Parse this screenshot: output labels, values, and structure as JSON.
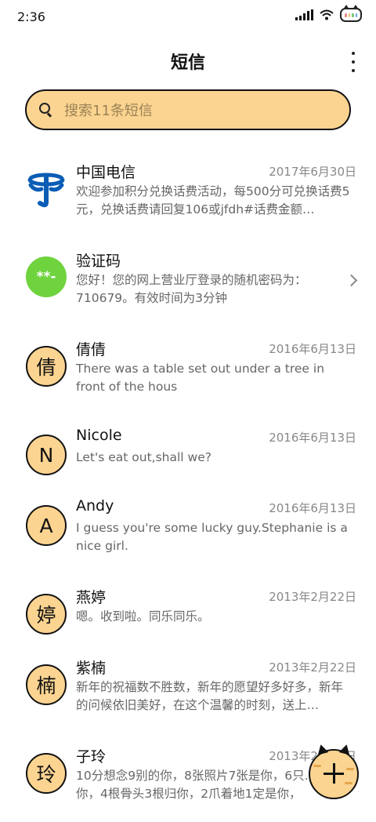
{
  "status_bar": {
    "time": "2:36"
  },
  "header": {
    "title": "短信"
  },
  "search": {
    "placeholder": "搜索11条短信"
  },
  "conversations": [
    {
      "name": "中国电信",
      "date": "2017年6月30日",
      "snippet": "欢迎参加积分兑换话费活动，每500分可兑换话费5元，兑换话费请回复106或jfdh#话费金额…",
      "avatar_type": "china-telecom-logo"
    },
    {
      "name": "验证码",
      "date": "",
      "snippet": "您好！您的网上营业厅登录的随机密码为：710679。有效时间为3分钟",
      "avatar_type": "verification-code",
      "avatar_text": "**-"
    },
    {
      "name": "倩倩",
      "date": "2016年6月13日",
      "snippet": "There was a table set out under a tree in front of the hous",
      "avatar_text": "倩"
    },
    {
      "name": "Nicole",
      "date": "2016年6月13日",
      "snippet": "Let's eat out,shall we?",
      "avatar_text": "N"
    },
    {
      "name": "Andy",
      "date": "2016年6月13日",
      "snippet": "I guess you're some lucky guy.Stephanie is a nice girl.",
      "avatar_text": "A"
    },
    {
      "name": "燕婷",
      "date": "2013年2月22日",
      "snippet": "嗯。收到啦。同乐同乐。",
      "avatar_text": "婷"
    },
    {
      "name": "紫楠",
      "date": "2013年2月22日",
      "snippet": "新年的祝福数不胜数，新年的愿望好多好多，新年的问候依旧美好，在这个温馨的时刻，送上…",
      "avatar_text": "楠"
    },
    {
      "name": "子玲",
      "date": "2013年2月22日",
      "snippet": "10分想念9别的你，8张照片7张是你，6只…只像你，4根骨头3根归你，2爪着地1定是你，",
      "avatar_text": "玲"
    }
  ],
  "colors": {
    "accent": "#fcd491",
    "border": "#111111",
    "green_avatar": "#6fd33e",
    "telecom_blue": "#0a5db5"
  },
  "icons": {
    "more": "more-vertical-icon",
    "search": "search-icon",
    "fab": "compose-plus-icon"
  }
}
